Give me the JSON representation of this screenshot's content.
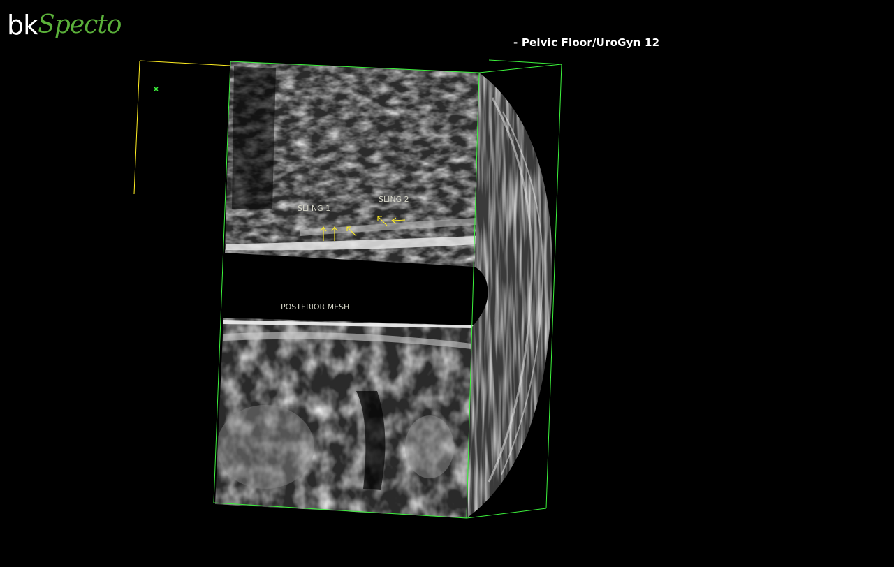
{
  "brand": {
    "prefix": "bk",
    "name": "Specto",
    "accent_color": "#5bb13a"
  },
  "header": {
    "preset_label": "- Pelvic Floor/UroGyn 12"
  },
  "volume": {
    "frame_color": "#3cf23c",
    "annotation_color": "#ffee22",
    "annotations": {
      "sling1": "SLI NG 1",
      "sling2": "SLING 2",
      "mesh": "POSTERIOR MESH"
    },
    "icons": [
      "orientation-marker-icon",
      "arrow-icon"
    ]
  }
}
